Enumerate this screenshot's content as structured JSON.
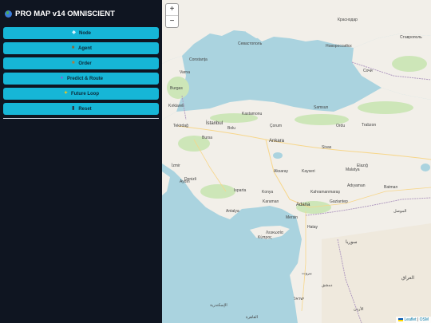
{
  "sidebar": {
    "title": "PRO MAP v14 OMNISCIENT",
    "buttons": [
      {
        "icon": "diamond-icon",
        "label": "Node"
      },
      {
        "icon": "truck-icon",
        "label": "Agent"
      },
      {
        "icon": "package-icon",
        "label": "Order"
      },
      {
        "icon": "crystal-ball-icon",
        "label": "Predict & Route"
      },
      {
        "icon": "sparkle-icon",
        "label": "Future Loop"
      },
      {
        "icon": "trash-icon",
        "label": "Reset"
      }
    ]
  },
  "map": {
    "zoom_in": "+",
    "zoom_out": "−",
    "attribution_leaflet": "Leaflet",
    "attribution_sep": " | ",
    "attribution_osm": "OSM",
    "labels": {
      "sea_black": "",
      "ankara": "Ankara",
      "istanbul": "İstanbul",
      "bursa": "Bursa",
      "izmir": "İzmir",
      "konya": "Konya",
      "adana": "Adana",
      "antalya": "Antalya",
      "samsun": "Samsun",
      "kayseri": "Kayseri",
      "trabzon": "Trabzon",
      "sivas": "Sivas",
      "malatya": "Malatya",
      "aksaray": "Aksaray",
      "eregli": "Ereğli",
      "kastamonu": "Kastamonu",
      "bolu": "Bolu",
      "corum": "Çorum",
      "ordu": "Ordu",
      "denizli": "Denizli",
      "mersin": "Mersin",
      "hatay": "Hatay",
      "kahramanmaras": "Kahramanmaraş",
      "gaziantep": "Gaziantep",
      "adiyaman": "Adıyaman",
      "batman": "Batman",
      "elazig": "Elazığ",
      "sinop": "Sinop",
      "isparta": "Isparta",
      "aydin": "Aydın",
      "karaman": "Karaman",
      "alanya": "Alanya",
      "tekirdag": "Tekirdağ",
      "kirklareli": "Kırklareli",
      "burgas": "Burgas",
      "varna": "Varna",
      "constanta": "Constanța",
      "sevastopol": "Севастополь",
      "krasnodar": "Краснодар",
      "novorossiysk": "Новороссийск",
      "stavropol": "Ставрополь",
      "sochi": "Сочи",
      "tbilisi": "",
      "nicosia": "Λευκωσία",
      "cyprus": "Κύπρος",
      "beirut": "بيروت",
      "damascus": "دمشق",
      "syria": "سوريا",
      "iraq": "العراق",
      "jordan": "الأردن",
      "israel": "ישראל",
      "cairo": "القاهرة",
      "alexandria": "الإسكندرية",
      "mosul": "الموصل"
    }
  },
  "colors": {
    "sidebar_bg": "#0f1521",
    "button_bg": "#16b6d7",
    "sea": "#aad3df",
    "land": "#f2efe9",
    "green": "#cde6b8"
  }
}
